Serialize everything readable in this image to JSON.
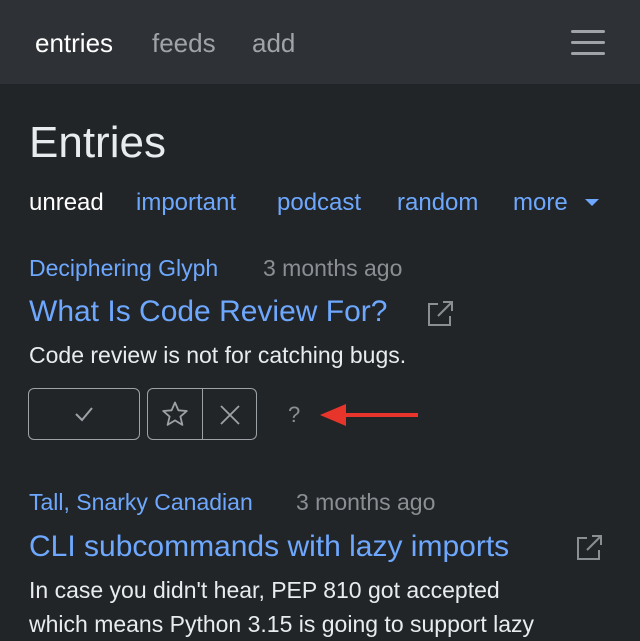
{
  "nav": {
    "items": [
      {
        "label": "entries",
        "active": true
      },
      {
        "label": "feeds",
        "active": false
      },
      {
        "label": "add",
        "active": false
      }
    ],
    "menu_icon": "hamburger-icon"
  },
  "page_title": "Entries",
  "filters": {
    "items": [
      "unread",
      "important",
      "podcast",
      "random"
    ],
    "more_label": "more",
    "more_icon": "caret-down-icon",
    "selected": "unread"
  },
  "entries": [
    {
      "feed": "Deciphering Glyph",
      "time": "3 months ago",
      "title": "What Is Code Review For?",
      "summary_lines": [
        "Code review is not for catching bugs."
      ],
      "actions": {
        "read_icon": "checkmark-icon",
        "important_icon": "star-icon",
        "dismiss_icon": "x-icon",
        "help_label": "?"
      }
    },
    {
      "feed": "Tall, Snarky Canadian",
      "time": "3 months ago",
      "title": "CLI subcommands with lazy imports",
      "summary_lines": [
        "In case you didn't hear, PEP 810 got accepted",
        "which means Python 3.15 is going to support lazy"
      ]
    }
  ],
  "colors": {
    "background": "#222528",
    "navbar": "#2e3236",
    "link": "#6ea8fe",
    "muted": "#8a8f94",
    "annotation_arrow": "#e8352b"
  }
}
